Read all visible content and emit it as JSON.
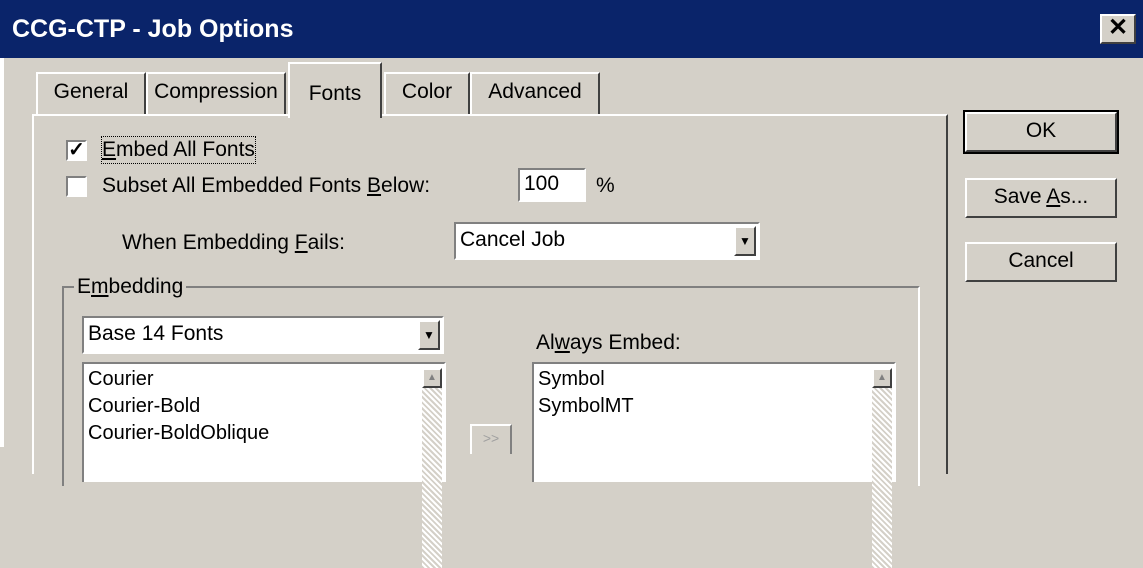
{
  "window": {
    "title": "CCG-CTP - Job Options",
    "close_label": "✕"
  },
  "tabs": [
    {
      "label": "General"
    },
    {
      "label": "Compression"
    },
    {
      "label": "Fonts"
    },
    {
      "label": "Color"
    },
    {
      "label": "Advanced"
    }
  ],
  "fonts": {
    "embed_all": {
      "pre": "",
      "key": "E",
      "post": "mbed All Fonts",
      "checked": true
    },
    "subset": {
      "pre": "Subset All Embedded Fonts ",
      "key": "B",
      "post": "elow:",
      "checked": false,
      "value": "100",
      "unit": "%"
    },
    "when_fails": {
      "pre": "When Embedding ",
      "key": "F",
      "post": "ails:",
      "value": "Cancel Job"
    },
    "embedding": {
      "pre": "E",
      "key": "m",
      "post": "bedding",
      "font_list_value": "Base 14 Fonts",
      "fonts": [
        "Courier",
        "Courier-Bold",
        "Courier-BoldOblique"
      ],
      "add_label": ">>",
      "always_embed": {
        "pre": "Al",
        "key": "w",
        "post": "ays Embed:"
      },
      "always_list": [
        "Symbol",
        "SymbolMT"
      ]
    }
  },
  "buttons": {
    "ok": "OK",
    "save_as": {
      "pre": "Save ",
      "key": "A",
      "post": "s..."
    },
    "cancel": "Cancel"
  }
}
